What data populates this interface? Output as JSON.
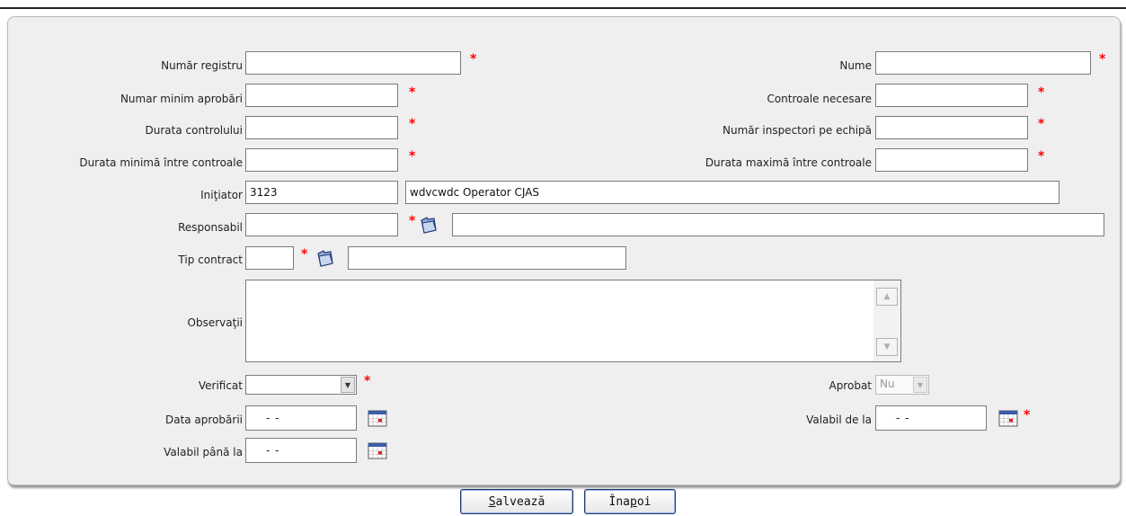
{
  "form": {
    "numar_registru": {
      "label": "Număr registru",
      "value": ""
    },
    "nume": {
      "label": "Nume",
      "value": ""
    },
    "numar_minim_aprobari": {
      "label": "Numar minim aprobări",
      "value": ""
    },
    "controale_necesare": {
      "label": "Controale necesare",
      "value": ""
    },
    "durata_controlului": {
      "label": "Durata controlului",
      "value": ""
    },
    "numar_inspectori": {
      "label": "Număr inspectori pe echipă",
      "value": ""
    },
    "durata_minima": {
      "label": "Durata minimă între controale",
      "value": ""
    },
    "durata_maxima": {
      "label": "Durata maximă între controale",
      "value": ""
    },
    "initiator": {
      "label": "Iniţiator",
      "code": "3123",
      "name": "wdvcwdc Operator CJAS"
    },
    "responsabil": {
      "label": "Responsabil",
      "code": "",
      "name": ""
    },
    "tip_contract": {
      "label": "Tip contract",
      "code": "",
      "name": ""
    },
    "observatii": {
      "label": "Observaţii",
      "value": ""
    },
    "verificat": {
      "label": "Verificat",
      "value": ""
    },
    "aprobat": {
      "label": "Aprobat",
      "value": "Nu"
    },
    "data_aprobarii": {
      "label": "Data aprobării",
      "value": "-   -"
    },
    "valabil_de_la": {
      "label": "Valabil de la",
      "value": "-   -"
    },
    "valabil_pana_la": {
      "label": "Valabil până la",
      "value": "-   -"
    },
    "required_mark": "*"
  },
  "buttons": {
    "save_first": "S",
    "save_rest": "alvează",
    "back_first": "Îna",
    "back_mid": "p",
    "back_rest": "oi"
  },
  "icons": {
    "folder": "folder-icon",
    "calendar": "calendar-icon",
    "accent": "#1d3b73",
    "required": "#ff0000"
  }
}
